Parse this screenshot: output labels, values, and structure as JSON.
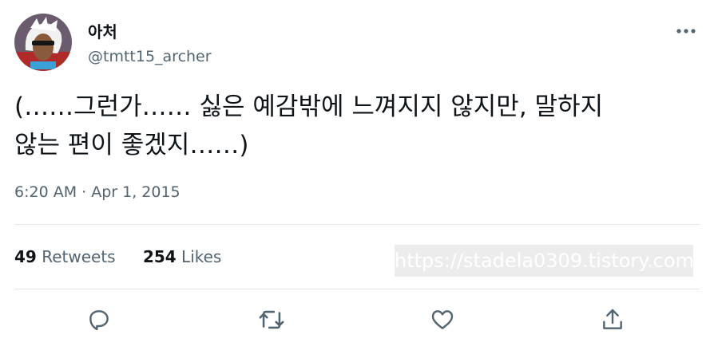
{
  "tweet": {
    "display_name": "아처",
    "handle": "@tmtt15_archer",
    "text_line1": "(……그런가…… 싫은 예감밖에 느껴지지 않지만, 말하지",
    "text_line2": "않는 편이 좋겠지……)",
    "timestamp": "6:20 AM · Apr 1, 2015"
  },
  "stats": {
    "retweets_count": "49",
    "retweets_label": "Retweets",
    "likes_count": "254",
    "likes_label": "Likes"
  },
  "watermark": "https://stadela0309.tistory.com",
  "icons": {
    "more": "more-horizontal-icon",
    "reply": "reply-icon",
    "retweet": "retweet-icon",
    "like": "heart-icon",
    "share": "share-icon"
  },
  "colors": {
    "text": "#0f1419",
    "secondary": "#536471",
    "divider": "#e1e6ea"
  }
}
